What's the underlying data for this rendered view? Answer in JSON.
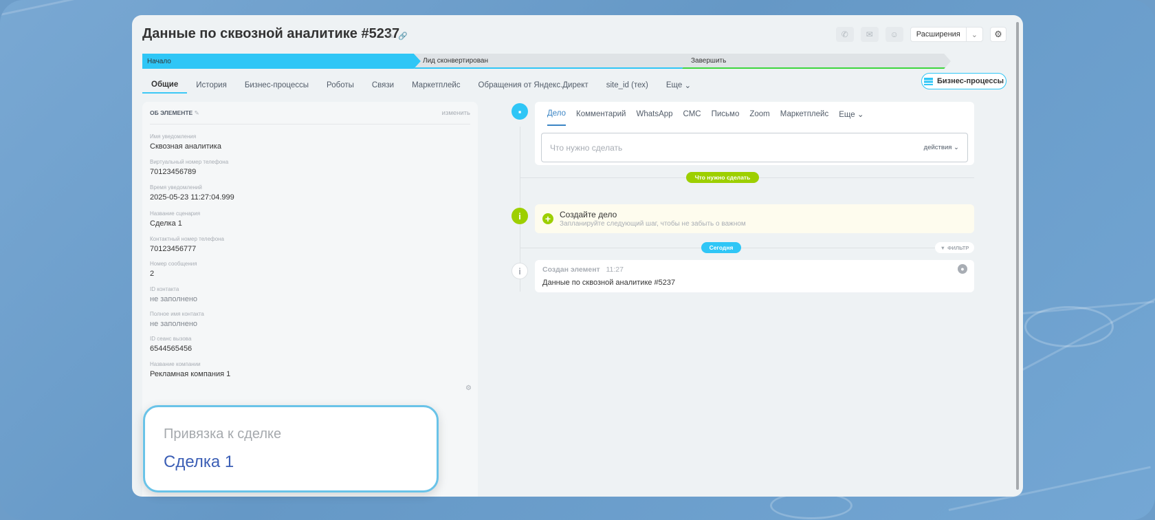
{
  "header": {
    "title": "Данные по сквозной аналитике #5237",
    "extensions_label": "Расширения"
  },
  "stages": [
    "Начало",
    "Лид сконвертирован",
    "Завершить"
  ],
  "tabs": [
    "Общие",
    "История",
    "Бизнес-процессы",
    "Роботы",
    "Связи",
    "Маркетплейс",
    "Обращения от Яндекс.Директ",
    "site_id (тех)",
    "Еще"
  ],
  "bp_button": "Бизнес-процессы",
  "about": {
    "title": "ОБ ЭЛЕМЕНТЕ",
    "edit": "изменить",
    "fields": [
      {
        "label": "Имя уведомления",
        "value": "Сквозная аналитика"
      },
      {
        "label": "Виртуальный номер телефона",
        "value": "70123456789"
      },
      {
        "label": "Время уведомлений",
        "value": "2025-05-23 11:27:04.999"
      },
      {
        "label": "Название сценария",
        "value": "Сделка 1"
      },
      {
        "label": "Контактный номер телефона",
        "value": "70123456777"
      },
      {
        "label": "Номер сообщения",
        "value": "2"
      },
      {
        "label": "ID контакта",
        "value": "не заполнено"
      },
      {
        "label": "Полное имя контакта",
        "value": "не заполнено"
      },
      {
        "label": "ID сеанс вызова",
        "value": "6544565456"
      },
      {
        "label": "Название компании",
        "value": "Рекламная компания 1"
      }
    ]
  },
  "popup": {
    "label": "Привязка к сделке",
    "value": "Сделка 1"
  },
  "activity": {
    "tabs": [
      "Дело",
      "Комментарий",
      "WhatsApp",
      "СМС",
      "Письмо",
      "Zoom",
      "Маркетплейс",
      "Еще"
    ],
    "placeholder": "Что нужно сделать",
    "actions": "действия"
  },
  "todo_pill": "Что нужно сделать",
  "create_task": {
    "title": "Создайте дело",
    "subtitle": "Запланируйте следующий шаг, чтобы не забыть о важном"
  },
  "today_pill": "Сегодня",
  "filter_label": "ФИЛЬТР",
  "created": {
    "title": "Создан элемент",
    "time": "11:27",
    "text": "Данные по сквозной аналитике #5237"
  },
  "colors": {
    "accent": "#2fc6f6",
    "green": "#9dcf00",
    "success": "#3dd63d",
    "link": "#3b5eb5"
  }
}
